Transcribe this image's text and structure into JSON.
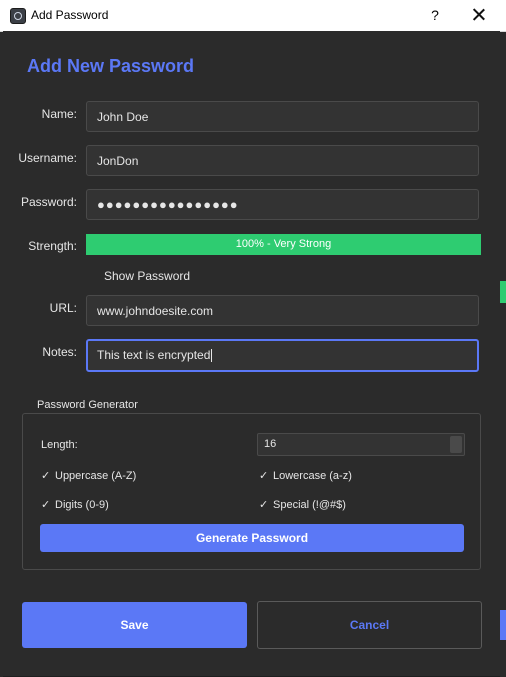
{
  "window": {
    "title": "Add Password",
    "help": "?",
    "close": "close"
  },
  "form": {
    "heading": "Add New Password",
    "name": {
      "label": "Name:",
      "value": "John Doe"
    },
    "username": {
      "label": "Username:",
      "value": "JonDon"
    },
    "password": {
      "label": "Password:",
      "value": "●●●●●●●●●●●●●●●●"
    },
    "strength": {
      "label": "Strength:",
      "text": "100% - Very Strong",
      "percent": 100,
      "color": "#2ecc71"
    },
    "show_password": "Show Password",
    "url": {
      "label": "URL:",
      "value": "www.johndoesite.com"
    },
    "notes": {
      "label": "Notes:",
      "value": "This text is encrypted"
    }
  },
  "generator": {
    "title": "Password Generator",
    "length_label": "Length:",
    "length_value": "16",
    "options": {
      "uppercase": {
        "label": "Uppercase (A-Z)",
        "checked": true
      },
      "lowercase": {
        "label": "Lowercase (a-z)",
        "checked": true
      },
      "digits": {
        "label": "Digits (0-9)",
        "checked": true
      },
      "special": {
        "label": "Special (!@#$)",
        "checked": true
      }
    },
    "check_mark": "✓",
    "button": "Generate Password"
  },
  "actions": {
    "save": "Save",
    "cancel": "Cancel"
  },
  "colors": {
    "accent": "#5b78f6",
    "strength": "#2ecc71",
    "background": "#2b2b2b"
  }
}
